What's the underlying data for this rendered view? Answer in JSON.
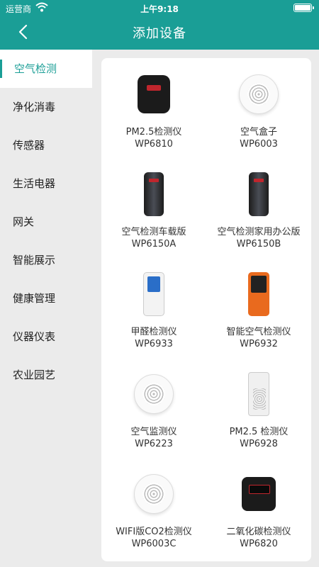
{
  "status_bar": {
    "carrier": "运营商",
    "time": "上午9:18"
  },
  "header": {
    "title": "添加设备",
    "back_icon": "chevron-left-icon"
  },
  "colors": {
    "accent": "#1a9e96",
    "sidebar_bg": "#ebebeb",
    "card_bg": "#ffffff"
  },
  "sidebar": {
    "items": [
      {
        "label": "空气检测",
        "active": true
      },
      {
        "label": "净化消毒"
      },
      {
        "label": "传感器"
      },
      {
        "label": "生活电器"
      },
      {
        "label": "网关"
      },
      {
        "label": "智能展示"
      },
      {
        "label": "健康管理"
      },
      {
        "label": "仪器仪表"
      },
      {
        "label": "农业园艺"
      }
    ]
  },
  "devices": [
    {
      "name": "PM2.5检测仪",
      "model": "WP6810",
      "icon": "pm25-detector-icon"
    },
    {
      "name": "空气盒子",
      "model": "WP6003",
      "icon": "air-box-icon"
    },
    {
      "name": "空气检测车载版",
      "model": "WP6150A",
      "icon": "car-air-detector-icon"
    },
    {
      "name": "空气检测家用办公版",
      "model": "WP6150B",
      "icon": "home-air-detector-icon"
    },
    {
      "name": "甲醛检测仪",
      "model": "WP6933",
      "icon": "formaldehyde-detector-icon"
    },
    {
      "name": "智能空气检测仪",
      "model": "WP6932",
      "icon": "smart-air-detector-icon"
    },
    {
      "name": "空气监测仪",
      "model": "WP6223",
      "icon": "air-monitor-icon"
    },
    {
      "name": "PM2.5 检测仪",
      "model": "WP6928",
      "icon": "pm25-monitor-icon"
    },
    {
      "name": "WIFI版CO2检测仪",
      "model": "WP6003C",
      "icon": "wifi-co2-detector-icon"
    },
    {
      "name": "二氧化碳检测仪",
      "model": "WP6820",
      "icon": "co2-detector-icon"
    }
  ]
}
